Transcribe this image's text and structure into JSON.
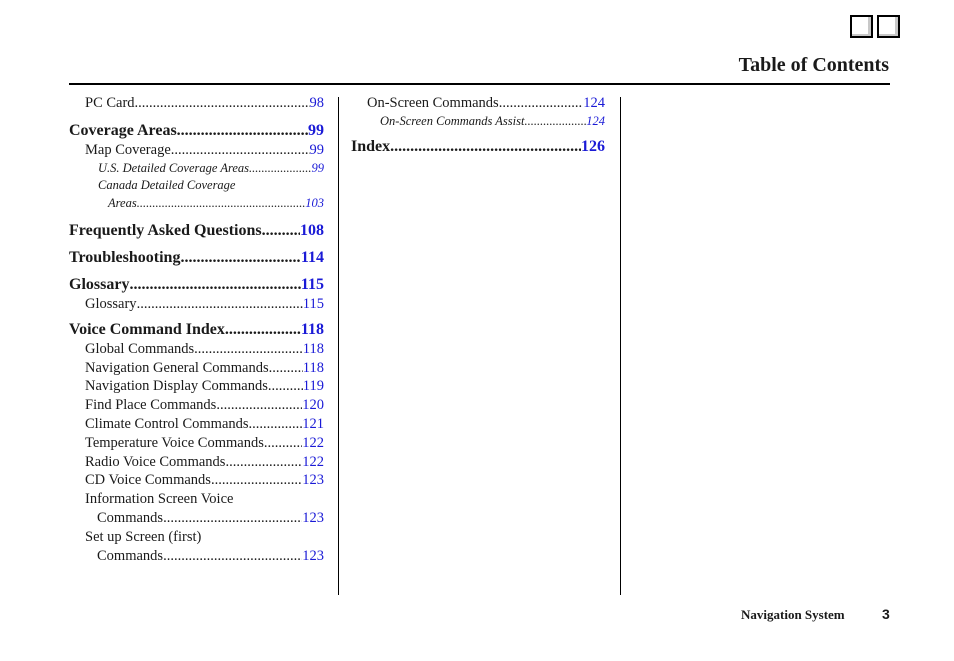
{
  "header": {
    "title": "Table of Contents",
    "nav_boxes": [
      "previous-page",
      "next-page"
    ]
  },
  "colors": {
    "page_number_link": "#1a1ad6",
    "text": "#1a1a1a",
    "rule": "#000000"
  },
  "column1": {
    "pc_card": {
      "label": "PC Card ",
      "page": "98"
    },
    "coverage_areas": {
      "label": "Coverage Areas",
      "page": "99"
    },
    "map_coverage": {
      "label": "Map Coverage ",
      "page": "99"
    },
    "us_detailed": {
      "label": "U.S. Detailed Coverage Areas",
      "page": " 99"
    },
    "canada_detailed_line1": "Canada Detailed Coverage",
    "canada_detailed_line2": {
      "label": "Areas",
      "page": " 103"
    },
    "faq": {
      "label": "Frequently Asked Questions",
      "page": "108"
    },
    "troubleshooting": {
      "label": "Troubleshooting",
      "page": "114"
    },
    "glossary_section": {
      "label": "Glossary ",
      "page": "115"
    },
    "glossary": {
      "label": "Glossary",
      "page": "115"
    },
    "voice_command_index": {
      "label": "Voice Command Index",
      "page": "118"
    },
    "global_commands": {
      "label": "Global Commands",
      "page": "118"
    },
    "nav_general": {
      "label": "Navigation General Commands ",
      "page": "118"
    },
    "nav_display": {
      "label": "Navigation Display Commands",
      "page": "119"
    },
    "find_place": {
      "label": "Find Place Commands",
      "page": "120"
    },
    "climate_control": {
      "label": "Climate Control Commands ",
      "page": "121"
    },
    "temperature_voice": {
      "label": "Temperature Voice Commands",
      "page": "122"
    },
    "radio_voice": {
      "label": "Radio Voice Commands",
      "page": "122"
    },
    "cd_voice": {
      "label": "CD Voice Commands",
      "page": "123"
    },
    "info_screen_line1": "Information Screen Voice",
    "info_screen_line2": {
      "label": "Commands",
      "page": "123"
    },
    "setup_screen_line1": "Set up Screen (first)",
    "setup_screen_line2": {
      "label": "Commands",
      "page": "123"
    }
  },
  "column2": {
    "on_screen_commands": {
      "label": "On-Screen Commands",
      "page": "124"
    },
    "on_screen_assist": {
      "label": "On-Screen Commands Assist",
      "page": "124"
    },
    "index": {
      "label": "Index ",
      "page": " 126"
    }
  },
  "footer": {
    "label": "Navigation System",
    "page_number": "3"
  }
}
